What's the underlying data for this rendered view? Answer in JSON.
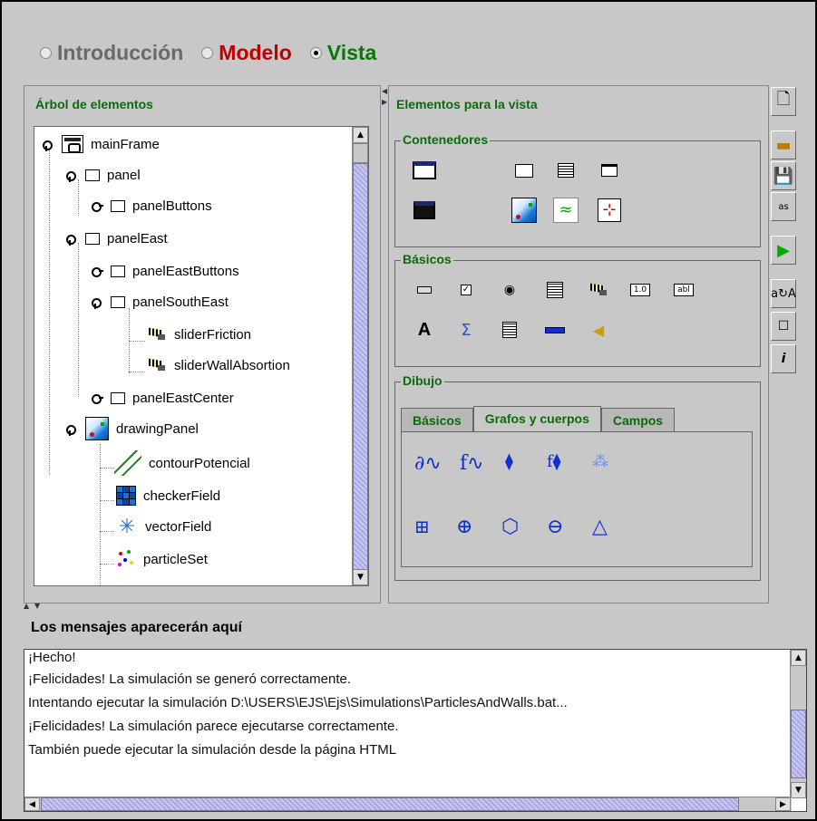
{
  "modes": [
    {
      "label": "Introducción",
      "color": "#6a6a6a",
      "selected": false
    },
    {
      "label": "Modelo",
      "color": "#c00000",
      "selected": false
    },
    {
      "label": "Vista",
      "color": "#007a00",
      "selected": true
    }
  ],
  "tree": {
    "title": "Árbol de elementos",
    "items": [
      {
        "label": "mainFrame"
      },
      {
        "label": "panel"
      },
      {
        "label": "panelButtons"
      },
      {
        "label": "panelEast"
      },
      {
        "label": "panelEastButtons"
      },
      {
        "label": "panelSouthEast"
      },
      {
        "label": "sliderFriction"
      },
      {
        "label": "sliderWallAbsortion"
      },
      {
        "label": "panelEastCenter"
      },
      {
        "label": "drawingPanel"
      },
      {
        "label": "contourPotencial"
      },
      {
        "label": "checkerField"
      },
      {
        "label": "vectorField"
      },
      {
        "label": "particleSet"
      }
    ]
  },
  "elements": {
    "title": "Elementos para la vista",
    "groups": {
      "containers": "Contenedores",
      "basics": "Básicos",
      "drawing": "Dibujo"
    },
    "drawing_tabs": [
      "Básicos",
      "Grafos y cuerpos",
      "Campos"
    ],
    "basic_labels": {
      "field_num": "1.0",
      "field_txt": "abl"
    }
  },
  "messages": {
    "title": "Los mensajes aparecerán aquí",
    "lines": [
      "¡Hecho!",
      "¡Felicidades! La simulación se generó correctamente.",
      "Intentando ejecutar la simulación D:\\USERS\\EJS\\Ejs\\Simulations\\ParticlesAndWalls.bat...",
      "¡Felicidades! La simulación parece ejecutarse correctamente.",
      "También puede ejecutar la simulación desde la página HTML"
    ]
  },
  "toolbar": {
    "icons": [
      "new-file-icon",
      "open-folder-icon",
      "save-icon",
      "save-as-icon",
      "run-icon",
      "search-replace-icon",
      "options-icon",
      "info-icon"
    ],
    "save_as_label": "as"
  }
}
